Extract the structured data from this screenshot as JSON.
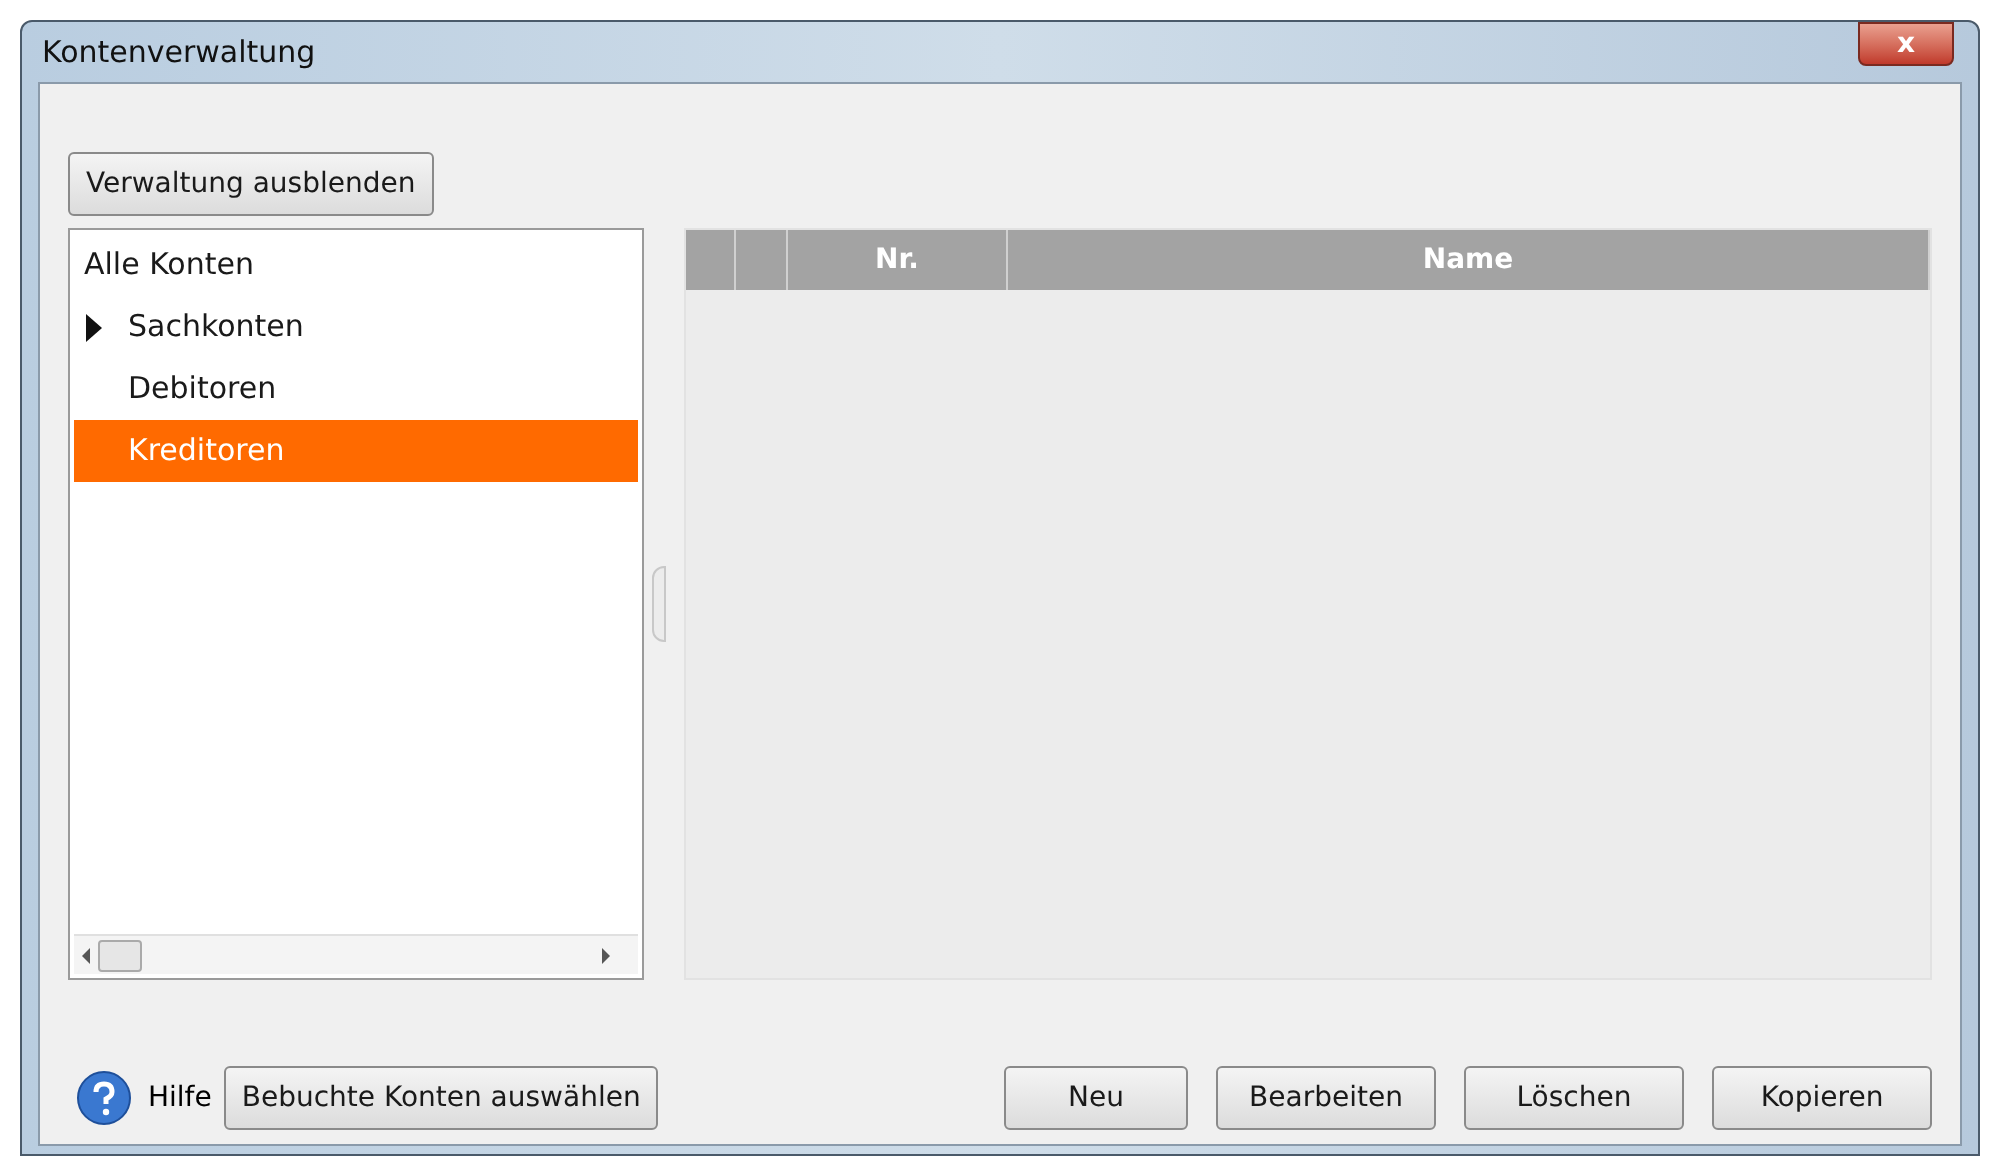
{
  "window": {
    "title": "Kontenverwaltung",
    "close": "x"
  },
  "toggle_button": "Verwaltung ausblenden",
  "tree": [
    {
      "label": "Alle Konten",
      "kind": "root",
      "selected": false,
      "children": [
        {
          "label": "Sachkonten",
          "kind": "group",
          "expanded": false,
          "selected": false
        },
        {
          "label": "Debitoren",
          "kind": "leaf",
          "selected": false
        },
        {
          "label": "Kreditoren",
          "kind": "leaf",
          "selected": true
        }
      ]
    }
  ],
  "table": {
    "columns": [
      "",
      "",
      "Nr.",
      "Name"
    ]
  },
  "footer": {
    "help": "Hilfe",
    "select_button": "Bebuchte Konten auswählen",
    "buttons": [
      "Neu",
      "Bearbeiten",
      "Löschen",
      "Kopieren"
    ]
  }
}
